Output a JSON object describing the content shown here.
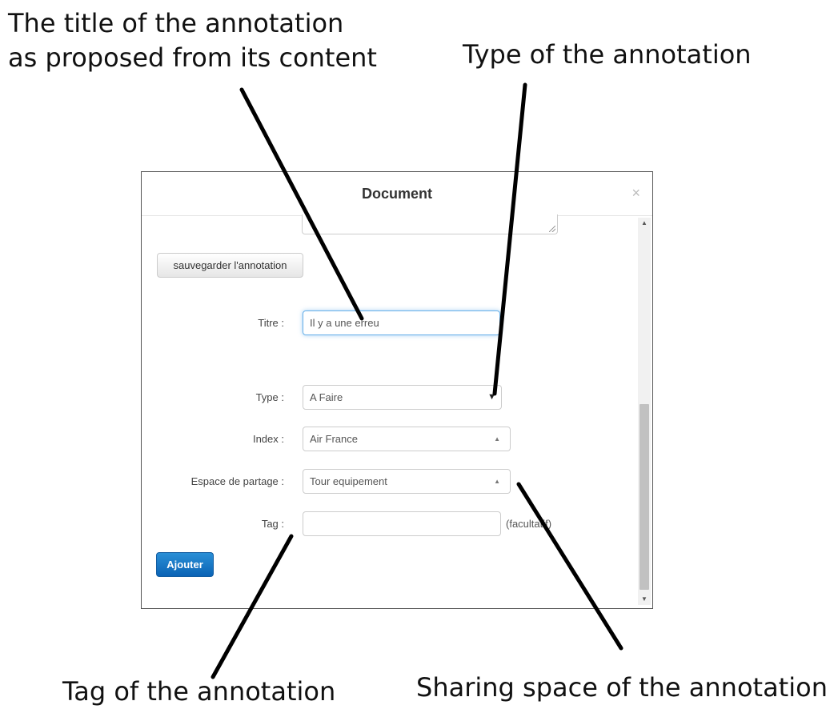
{
  "callouts": {
    "title_line1": "The title of the annotation",
    "title_line2": "as proposed from its content",
    "type": "Type of the annotation",
    "tag": "Tag of the annotation",
    "sharing": "Sharing space of the annotation"
  },
  "modal": {
    "title": "Document",
    "close": "×",
    "save_button": "sauvegarder l'annotation",
    "fields": {
      "titre": {
        "label": "Titre :",
        "value": "Il y a une erreu"
      },
      "type": {
        "label": "Type :",
        "value": "A Faire"
      },
      "index": {
        "label": "Index :",
        "value": "Air France"
      },
      "espace": {
        "label": "Espace de partage :",
        "value": "Tour equipement"
      },
      "tag": {
        "label": "Tag :",
        "value": "",
        "hint": "(facultatif)"
      }
    },
    "add_button": "Ajouter"
  },
  "icons": {
    "close": "close-icon",
    "type_arrow": "caret-down-icon",
    "select_arrow": "caret-up-icon"
  },
  "colors": {
    "primary_button": "#0a63b5",
    "focus_border": "#66afe9"
  }
}
